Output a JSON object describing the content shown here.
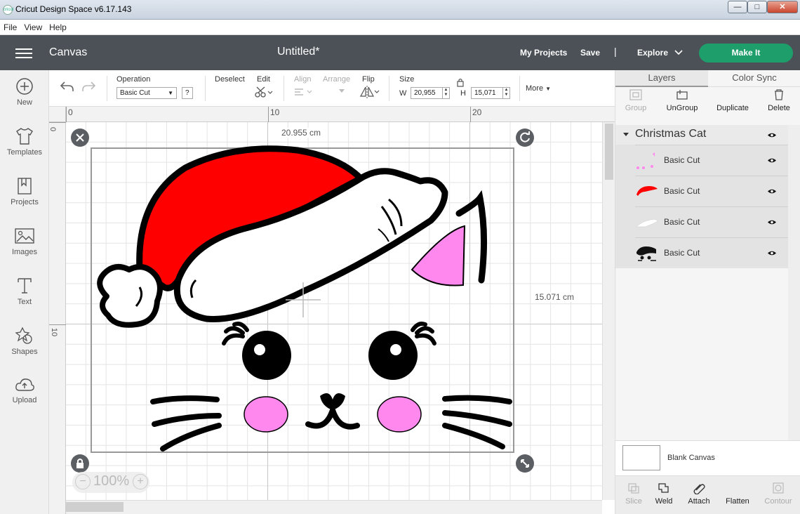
{
  "window": {
    "title": "Cricut Design Space  v6.17.143",
    "icon_text": "cricut"
  },
  "window_controls": {
    "minimize": "—",
    "maximize": "□",
    "close": "✕"
  },
  "menu": [
    "File",
    "View",
    "Help"
  ],
  "header": {
    "section": "Canvas",
    "document_title": "Untitled*",
    "my_projects": "My Projects",
    "save": "Save",
    "separator": "|",
    "explore": "Explore",
    "make_it": "Make It"
  },
  "left_nav": [
    {
      "label": "New",
      "icon": "plus-circle-icon"
    },
    {
      "label": "Templates",
      "icon": "tshirt-icon"
    },
    {
      "label": "Projects",
      "icon": "bookmark-icon"
    },
    {
      "label": "Images",
      "icon": "image-icon"
    },
    {
      "label": "Text",
      "icon": "text-icon"
    },
    {
      "label": "Shapes",
      "icon": "shapes-icon"
    },
    {
      "label": "Upload",
      "icon": "cloud-upload-icon"
    }
  ],
  "toolbar": {
    "operation_label": "Operation",
    "operation_value": "Basic Cut",
    "help": "?",
    "deselect": "Deselect",
    "edit": "Edit",
    "align": "Align",
    "arrange": "Arrange",
    "flip": "Flip",
    "size": "Size",
    "w_label": "W",
    "w_value": "20,955",
    "h_label": "H",
    "h_value": "15,071",
    "more": "More"
  },
  "rulers": {
    "h": [
      "0",
      "10",
      "20"
    ],
    "v": [
      "0",
      "10"
    ]
  },
  "canvas": {
    "width_label": "20.955 cm",
    "height_label": "15.071 cm",
    "zoom": "100%",
    "zoom_minus": "−",
    "zoom_plus": "+"
  },
  "colors": {
    "red": "#ff0000",
    "pink": "#ff88ee",
    "accent": "#1e9e6b",
    "header": "#4b5157"
  },
  "right_panel": {
    "tabs": [
      "Layers",
      "Color Sync"
    ],
    "tools": [
      {
        "label": "Group",
        "enabled": false
      },
      {
        "label": "UnGroup",
        "enabled": true
      },
      {
        "label": "Duplicate",
        "enabled": true
      },
      {
        "label": "Delete",
        "enabled": true
      }
    ],
    "group_name": "Christmas Cat",
    "layers": [
      {
        "name": "Basic Cut",
        "thumb": "pink-dots"
      },
      {
        "name": "Basic Cut",
        "thumb": "red-hat"
      },
      {
        "name": "Basic Cut",
        "thumb": "white-shape"
      },
      {
        "name": "Basic Cut",
        "thumb": "black-cat"
      }
    ],
    "blank_canvas": "Blank Canvas",
    "bottom_tools": [
      {
        "label": "Slice",
        "enabled": false
      },
      {
        "label": "Weld",
        "enabled": true
      },
      {
        "label": "Attach",
        "enabled": true
      },
      {
        "label": "Flatten",
        "enabled": true
      },
      {
        "label": "Contour",
        "enabled": false
      }
    ]
  }
}
